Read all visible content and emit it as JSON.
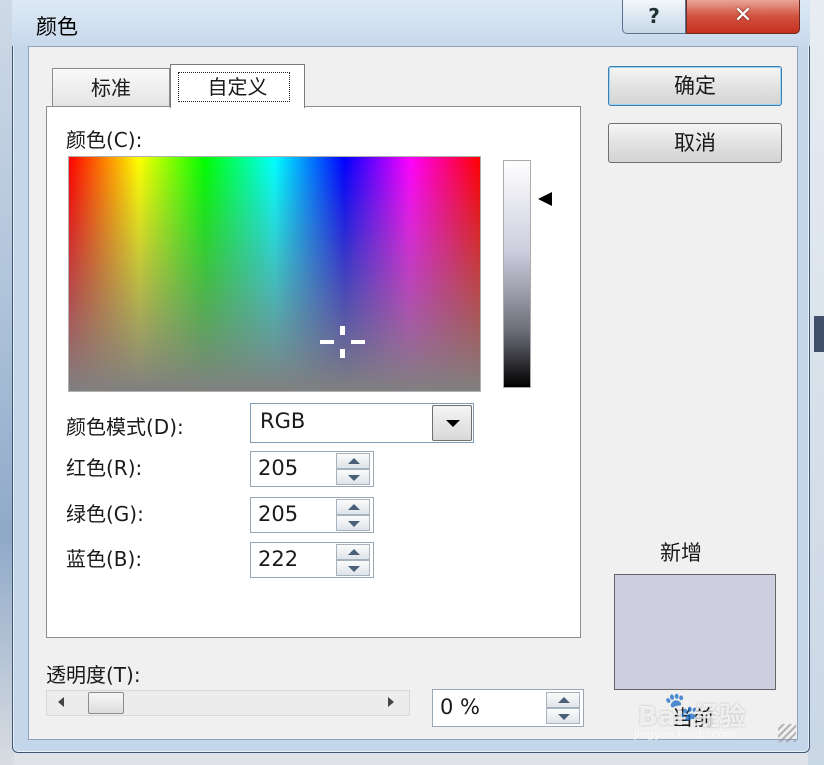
{
  "window": {
    "title": "颜色",
    "help_label": "?",
    "close_label": "✕"
  },
  "tabs": [
    {
      "label": "标准",
      "active": false
    },
    {
      "label": "自定义",
      "active": true
    }
  ],
  "custom": {
    "colors_label": "颜色(C):",
    "mode_label": "颜色模式(D):",
    "mode_value": "RGB",
    "red_label": "红色(R):",
    "red_value": "205",
    "green_label": "绿色(G):",
    "green_value": "205",
    "blue_label": "蓝色(B):",
    "blue_value": "222"
  },
  "buttons": {
    "ok": "确定",
    "cancel": "取消"
  },
  "preview": {
    "new_label": "新增",
    "current_label": "当前",
    "new_color": "#cdcdde"
  },
  "transparency": {
    "label": "透明度(T):",
    "value": "0 %"
  },
  "watermark": {
    "paw": "🐾",
    "main": "Bai 经验",
    "url": "jingyan.baidu.com"
  },
  "colors": {
    "accent": "#3c7fb1",
    "close": "#c4301c"
  }
}
